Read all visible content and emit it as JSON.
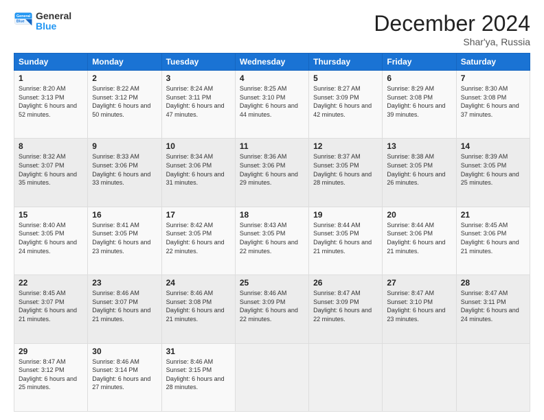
{
  "logo": {
    "line1": "General",
    "line2": "Blue"
  },
  "title": "December 2024",
  "location": "Shar'ya, Russia",
  "days_header": [
    "Sunday",
    "Monday",
    "Tuesday",
    "Wednesday",
    "Thursday",
    "Friday",
    "Saturday"
  ],
  "weeks": [
    [
      {
        "day": "1",
        "sunrise": "8:20 AM",
        "sunset": "3:13 PM",
        "daylight": "6 hours and 52 minutes."
      },
      {
        "day": "2",
        "sunrise": "8:22 AM",
        "sunset": "3:12 PM",
        "daylight": "6 hours and 50 minutes."
      },
      {
        "day": "3",
        "sunrise": "8:24 AM",
        "sunset": "3:11 PM",
        "daylight": "6 hours and 47 minutes."
      },
      {
        "day": "4",
        "sunrise": "8:25 AM",
        "sunset": "3:10 PM",
        "daylight": "6 hours and 44 minutes."
      },
      {
        "day": "5",
        "sunrise": "8:27 AM",
        "sunset": "3:09 PM",
        "daylight": "6 hours and 42 minutes."
      },
      {
        "day": "6",
        "sunrise": "8:29 AM",
        "sunset": "3:08 PM",
        "daylight": "6 hours and 39 minutes."
      },
      {
        "day": "7",
        "sunrise": "8:30 AM",
        "sunset": "3:08 PM",
        "daylight": "6 hours and 37 minutes."
      }
    ],
    [
      {
        "day": "8",
        "sunrise": "8:32 AM",
        "sunset": "3:07 PM",
        "daylight": "6 hours and 35 minutes."
      },
      {
        "day": "9",
        "sunrise": "8:33 AM",
        "sunset": "3:06 PM",
        "daylight": "6 hours and 33 minutes."
      },
      {
        "day": "10",
        "sunrise": "8:34 AM",
        "sunset": "3:06 PM",
        "daylight": "6 hours and 31 minutes."
      },
      {
        "day": "11",
        "sunrise": "8:36 AM",
        "sunset": "3:06 PM",
        "daylight": "6 hours and 29 minutes."
      },
      {
        "day": "12",
        "sunrise": "8:37 AM",
        "sunset": "3:05 PM",
        "daylight": "6 hours and 28 minutes."
      },
      {
        "day": "13",
        "sunrise": "8:38 AM",
        "sunset": "3:05 PM",
        "daylight": "6 hours and 26 minutes."
      },
      {
        "day": "14",
        "sunrise": "8:39 AM",
        "sunset": "3:05 PM",
        "daylight": "6 hours and 25 minutes."
      }
    ],
    [
      {
        "day": "15",
        "sunrise": "8:40 AM",
        "sunset": "3:05 PM",
        "daylight": "6 hours and 24 minutes."
      },
      {
        "day": "16",
        "sunrise": "8:41 AM",
        "sunset": "3:05 PM",
        "daylight": "6 hours and 23 minutes."
      },
      {
        "day": "17",
        "sunrise": "8:42 AM",
        "sunset": "3:05 PM",
        "daylight": "6 hours and 22 minutes."
      },
      {
        "day": "18",
        "sunrise": "8:43 AM",
        "sunset": "3:05 PM",
        "daylight": "6 hours and 22 minutes."
      },
      {
        "day": "19",
        "sunrise": "8:44 AM",
        "sunset": "3:05 PM",
        "daylight": "6 hours and 21 minutes."
      },
      {
        "day": "20",
        "sunrise": "8:44 AM",
        "sunset": "3:06 PM",
        "daylight": "6 hours and 21 minutes."
      },
      {
        "day": "21",
        "sunrise": "8:45 AM",
        "sunset": "3:06 PM",
        "daylight": "6 hours and 21 minutes."
      }
    ],
    [
      {
        "day": "22",
        "sunrise": "8:45 AM",
        "sunset": "3:07 PM",
        "daylight": "6 hours and 21 minutes."
      },
      {
        "day": "23",
        "sunrise": "8:46 AM",
        "sunset": "3:07 PM",
        "daylight": "6 hours and 21 minutes."
      },
      {
        "day": "24",
        "sunrise": "8:46 AM",
        "sunset": "3:08 PM",
        "daylight": "6 hours and 21 minutes."
      },
      {
        "day": "25",
        "sunrise": "8:46 AM",
        "sunset": "3:09 PM",
        "daylight": "6 hours and 22 minutes."
      },
      {
        "day": "26",
        "sunrise": "8:47 AM",
        "sunset": "3:09 PM",
        "daylight": "6 hours and 22 minutes."
      },
      {
        "day": "27",
        "sunrise": "8:47 AM",
        "sunset": "3:10 PM",
        "daylight": "6 hours and 23 minutes."
      },
      {
        "day": "28",
        "sunrise": "8:47 AM",
        "sunset": "3:11 PM",
        "daylight": "6 hours and 24 minutes."
      }
    ],
    [
      {
        "day": "29",
        "sunrise": "8:47 AM",
        "sunset": "3:12 PM",
        "daylight": "6 hours and 25 minutes."
      },
      {
        "day": "30",
        "sunrise": "8:46 AM",
        "sunset": "3:14 PM",
        "daylight": "6 hours and 27 minutes."
      },
      {
        "day": "31",
        "sunrise": "8:46 AM",
        "sunset": "3:15 PM",
        "daylight": "6 hours and 28 minutes."
      },
      null,
      null,
      null,
      null
    ]
  ],
  "labels": {
    "sunrise": "Sunrise:",
    "sunset": "Sunset:",
    "daylight": "Daylight:"
  }
}
